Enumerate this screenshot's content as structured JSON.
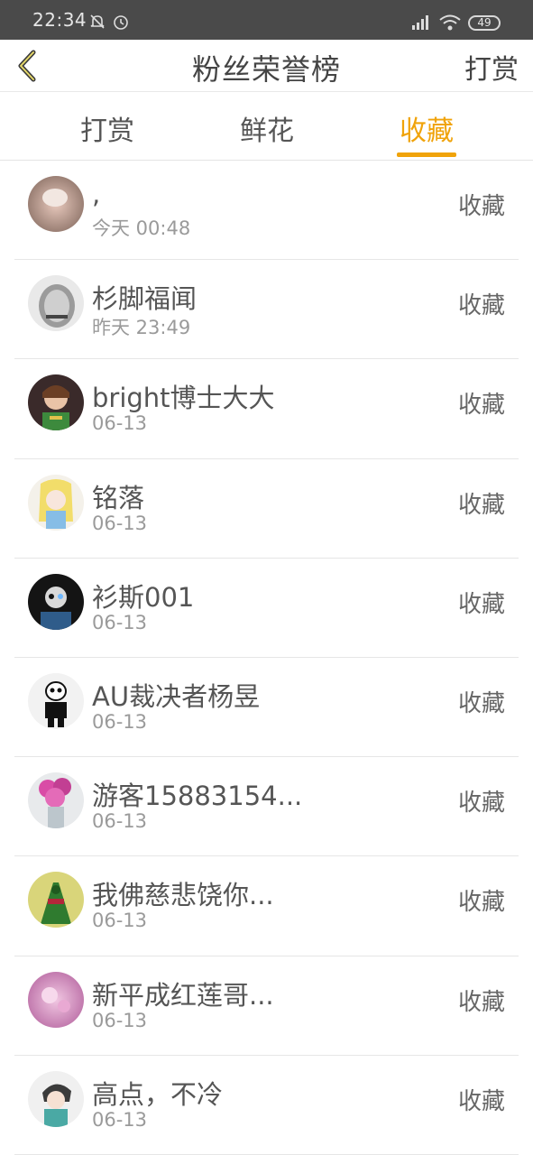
{
  "status": {
    "time": "22:34",
    "battery": "49"
  },
  "header": {
    "title": "粉丝荣誉榜",
    "action": "打赏"
  },
  "tabs": [
    {
      "label": "打赏"
    },
    {
      "label": "鲜花"
    },
    {
      "label": "收藏"
    }
  ],
  "rows": [
    {
      "name": ",",
      "date": "今天 00:48",
      "tag": "收藏"
    },
    {
      "name": "杉脚福闻",
      "date": "昨天 23:49",
      "tag": "收藏"
    },
    {
      "name": "bright博士大大",
      "date": "06-13",
      "tag": "收藏"
    },
    {
      "name": "铭落",
      "date": "06-13",
      "tag": "收藏"
    },
    {
      "name": "衫斯001",
      "date": "06-13",
      "tag": "收藏"
    },
    {
      "name": "AU裁决者杨昱",
      "date": "06-13",
      "tag": "收藏"
    },
    {
      "name": "游客15883154...",
      "date": "06-13",
      "tag": "收藏"
    },
    {
      "name": "我佛慈悲饶你...",
      "date": "06-13",
      "tag": "收藏"
    },
    {
      "name": "新平成红莲哥...",
      "date": "06-13",
      "tag": "收藏"
    },
    {
      "name": "高点，不冷",
      "date": "06-13",
      "tag": "收藏"
    }
  ],
  "colors": {
    "accent": "#f0a30a",
    "statusbar": "#4a4a4a"
  }
}
